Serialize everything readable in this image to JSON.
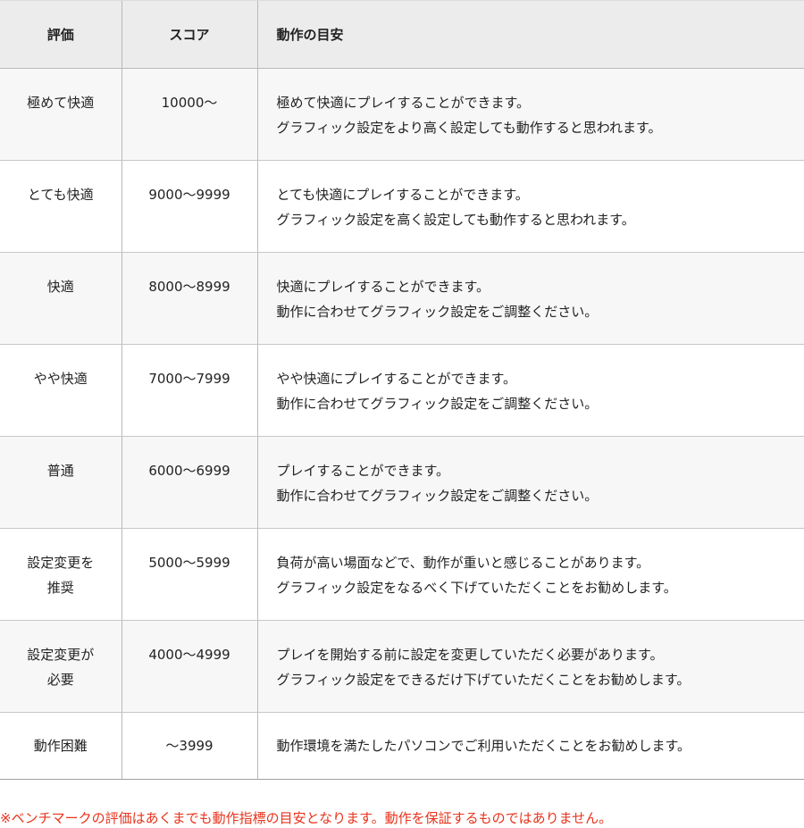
{
  "table": {
    "headers": {
      "rating": "評価",
      "score": "スコア",
      "guide": "動作の目安"
    },
    "rows": [
      {
        "rating": [
          "極めて快適"
        ],
        "score": "10000～",
        "guide": [
          "極めて快適にプレイすることができます。",
          "グラフィック設定をより高く設定しても動作すると思われます。"
        ]
      },
      {
        "rating": [
          "とても快適"
        ],
        "score": "9000～9999",
        "guide": [
          "とても快適にプレイすることができます。",
          "グラフィック設定を高く設定しても動作すると思われます。"
        ]
      },
      {
        "rating": [
          "快適"
        ],
        "score": "8000～8999",
        "guide": [
          "快適にプレイすることができます。",
          "動作に合わせてグラフィック設定をご調整ください。"
        ]
      },
      {
        "rating": [
          "やや快適"
        ],
        "score": "7000～7999",
        "guide": [
          "やや快適にプレイすることができます。",
          "動作に合わせてグラフィック設定をご調整ください。"
        ]
      },
      {
        "rating": [
          "普通"
        ],
        "score": "6000～6999",
        "guide": [
          "プレイすることができます。",
          "動作に合わせてグラフィック設定をご調整ください。"
        ]
      },
      {
        "rating": [
          "設定変更を",
          "推奨"
        ],
        "score": "5000～5999",
        "guide": [
          "負荷が高い場面などで、動作が重いと感じることがあります。",
          "グラフィック設定をなるべく下げていただくことをお勧めします。"
        ]
      },
      {
        "rating": [
          "設定変更が",
          "必要"
        ],
        "score": "4000～4999",
        "guide": [
          "プレイを開始する前に設定を変更していただく必要があります。",
          "グラフィック設定をできるだけ下げていただくことをお勧めします。"
        ]
      },
      {
        "rating": [
          "動作困難"
        ],
        "score": "～3999",
        "guide": [
          "動作環境を満たしたパソコンでご利用いただくことをお勧めします。"
        ]
      }
    ]
  },
  "footnote": "※ベンチマークの評価はあくまでも動作指標の目安となります。動作を保証するものではありません。"
}
